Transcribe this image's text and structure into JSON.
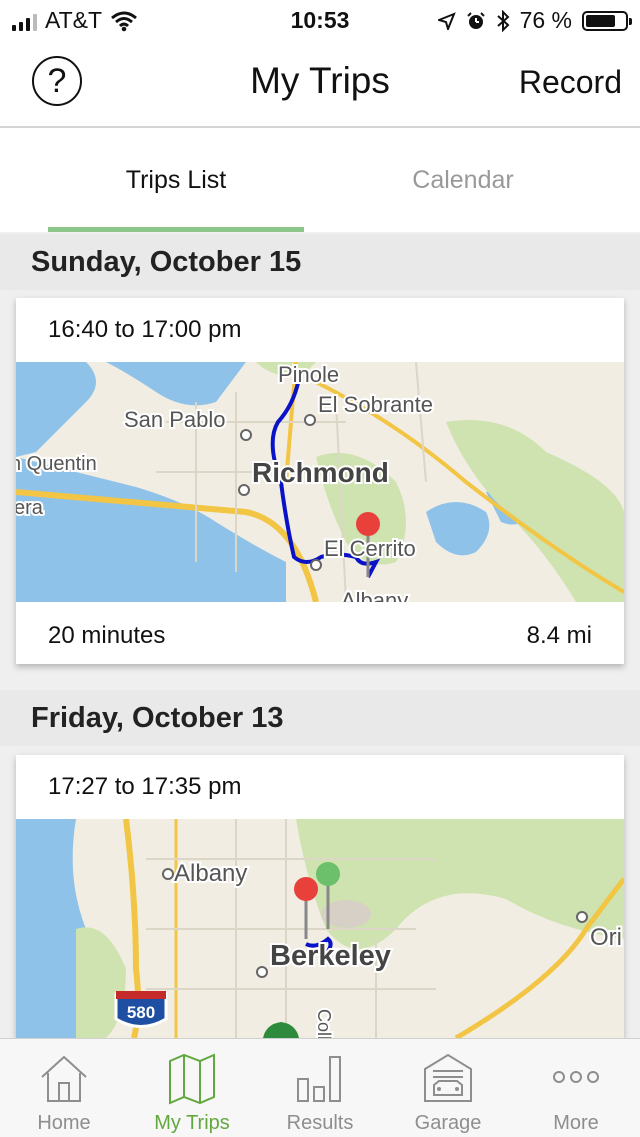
{
  "status_bar": {
    "carrier": "AT&T",
    "time": "10:53",
    "battery": "76 %",
    "battery_level": 0.76,
    "icons": [
      "signal-icon",
      "wifi-icon",
      "location-arrow-icon",
      "alarm-icon",
      "bluetooth-icon",
      "battery-icon"
    ]
  },
  "nav": {
    "help_glyph": "?",
    "title": "My Trips",
    "record_label": "Record"
  },
  "tabs": {
    "active": "Trips List",
    "inactive": "Calendar"
  },
  "trips": [
    {
      "date": "Sunday, October 15",
      "time_range": "16:40 to 17:00 pm",
      "duration": "20 minutes",
      "distance": "8.4 mi",
      "map_labels": [
        "Pinole",
        "El Sobrante",
        "San Pablo",
        "n Quentin",
        "Richmond",
        "era",
        "El Cerrito",
        "Albany"
      ]
    },
    {
      "date": "Friday, October 13",
      "time_range": "17:27 to 17:35 pm",
      "map_labels": [
        "Albany",
        "Berkeley",
        "Ori",
        "580",
        "Coll"
      ]
    }
  ],
  "colors": {
    "accent": "#63a83f",
    "route": "#0a12c8",
    "pin_start": "#e8403a",
    "pin_end": "#6cbf6b",
    "water": "#8fc2e8",
    "land": "#f1ede3",
    "park": "#cfe3b0"
  },
  "tab_bar": [
    {
      "label": "Home",
      "icon": "home-icon"
    },
    {
      "label": "My Trips",
      "icon": "map-icon",
      "active": true
    },
    {
      "label": "Results",
      "icon": "bar-chart-icon"
    },
    {
      "label": "Garage",
      "icon": "garage-icon"
    },
    {
      "label": "More",
      "icon": "more-icon"
    }
  ]
}
